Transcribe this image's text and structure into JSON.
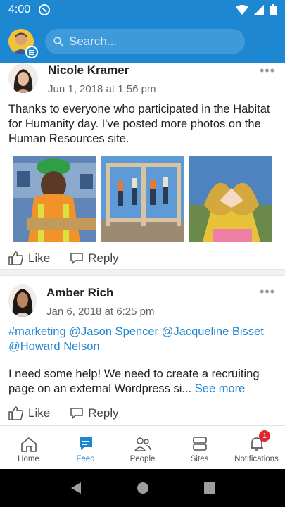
{
  "status_bar": {
    "time": "4:00"
  },
  "header": {
    "search_placeholder": "Search..."
  },
  "posts": [
    {
      "author": "Nicole Kramer",
      "date": "Jun 1, 2018 at 1:56 pm",
      "text": "Thanks to everyone who participated in the Habitat for Humanity day. I've posted more photos on the Human Resources site.",
      "like_label": "Like",
      "reply_label": "Reply"
    },
    {
      "author": "Amber Rich",
      "date": "Jan 6, 2018 at 6:25 pm",
      "mentions": [
        "#marketing",
        "@Jason Spencer",
        "@Jacqueline Bisset",
        "@Howard Nelson"
      ],
      "text": "I need some help! We need to create a recruiting page on an external Wordpress si...",
      "see_more": "See more",
      "like_label": "Like",
      "reply_label": "Reply"
    }
  ],
  "bottom_nav": {
    "items": [
      {
        "label": "Home"
      },
      {
        "label": "Feed"
      },
      {
        "label": "People"
      },
      {
        "label": "Sites"
      },
      {
        "label": "Notifications"
      }
    ],
    "notifications_badge": "1"
  },
  "colors": {
    "brand": "#1e87d2",
    "badge": "#e0282e"
  }
}
